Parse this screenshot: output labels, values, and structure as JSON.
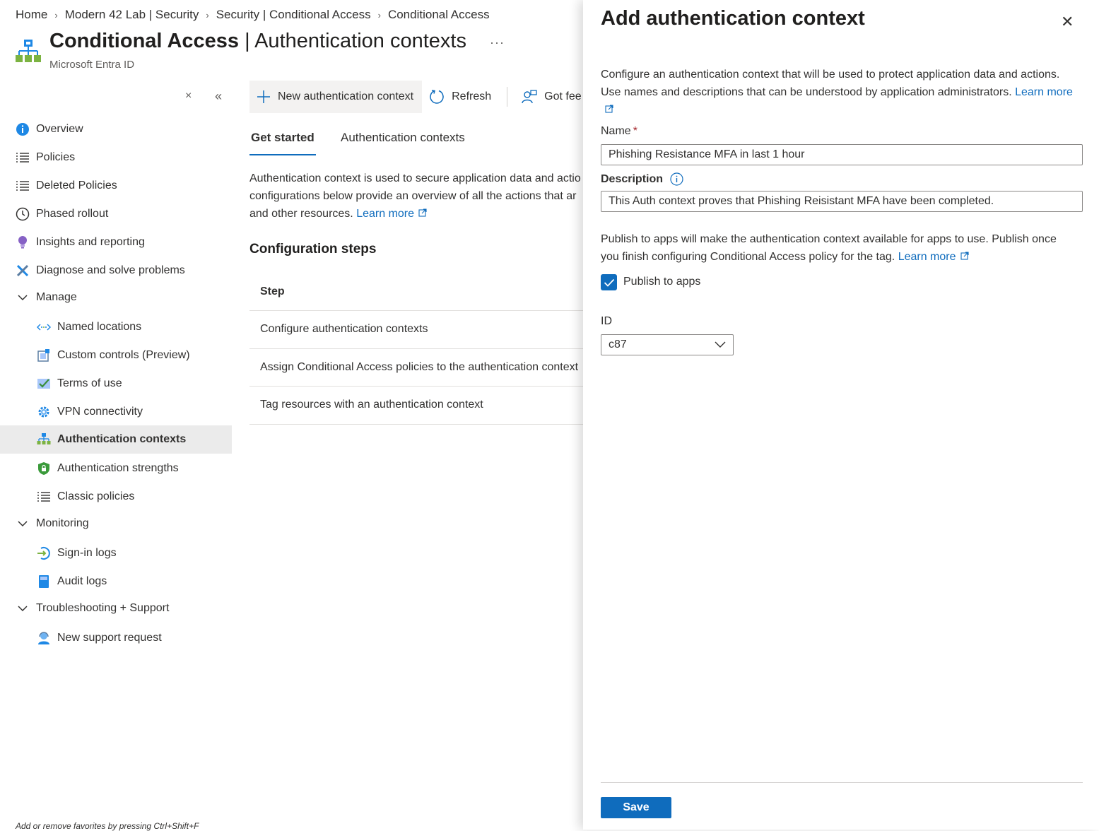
{
  "breadcrumb": [
    "Home",
    "Modern 42 Lab | Security",
    "Security | Conditional Access",
    "Conditional Access"
  ],
  "header": {
    "title_bold": "Conditional Access",
    "title_rest": " | Authentication contexts",
    "subtitle": "Microsoft Entra ID",
    "more": "···"
  },
  "sidebar": {
    "close_glyph": "×",
    "collapse_glyph": "«",
    "items": [
      {
        "label": "Overview",
        "icon": "info-icon"
      },
      {
        "label": "Policies",
        "icon": "list-icon"
      },
      {
        "label": "Deleted Policies",
        "icon": "list-icon"
      },
      {
        "label": "Phased rollout",
        "icon": "clock-icon"
      },
      {
        "label": "Insights and reporting",
        "icon": "lightbulb-icon"
      },
      {
        "label": "Diagnose and solve problems",
        "icon": "wrench-icon"
      }
    ],
    "manage": {
      "label": "Manage",
      "items": [
        {
          "label": "Named locations",
          "icon": "location-arrows-icon"
        },
        {
          "label": "Custom controls (Preview)",
          "icon": "custom-controls-icon"
        },
        {
          "label": "Terms of use",
          "icon": "checklist-icon"
        },
        {
          "label": "VPN connectivity",
          "icon": "gear-icon"
        },
        {
          "label": "Authentication contexts",
          "icon": "hierarchy-icon"
        },
        {
          "label": "Authentication strengths",
          "icon": "shield-lock-icon"
        },
        {
          "label": "Classic policies",
          "icon": "list-icon"
        }
      ]
    },
    "monitoring": {
      "label": "Monitoring",
      "items": [
        {
          "label": "Sign-in logs",
          "icon": "sign-in-icon"
        },
        {
          "label": "Audit logs",
          "icon": "book-icon"
        }
      ]
    },
    "support": {
      "label": "Troubleshooting + Support",
      "items": [
        {
          "label": "New support request",
          "icon": "person-headset-icon"
        }
      ]
    },
    "favorites_hint": "Add or remove favorites by pressing Ctrl+Shift+F"
  },
  "toolbar": {
    "new_context": "New authentication context",
    "refresh": "Refresh",
    "feedback": "Got fee"
  },
  "tabs": [
    "Get started",
    "Authentication contexts"
  ],
  "intro": {
    "line1": "Authentication context is used to secure application data and actio",
    "line2": "configurations below provide an overview of all the actions that ar",
    "line3": "and other resources. ",
    "learn_more": "Learn more"
  },
  "config_heading": "Configuration steps",
  "steps": {
    "header": "Step",
    "rows": [
      "Configure authentication contexts",
      "Assign Conditional Access policies to the authentication context",
      "Tag resources with an authentication context"
    ]
  },
  "panel": {
    "title": "Add authentication context",
    "close_glyph": "✕",
    "desc_line1": "Configure an authentication context that will be used to protect application data and actions.",
    "desc_line2": "Use names and descriptions that can be understood by application administrators. ",
    "desc_learn_more": "Learn more",
    "name_label": "Name",
    "name_required": "*",
    "name_value": "Phishing Resistance MFA in last 1 hour",
    "description_label": "Description",
    "description_value": "This Auth context proves that Phishing Reisistant MFA have been completed.",
    "publish_desc_line1": "Publish to apps will make the authentication context available for apps to use. Publish once",
    "publish_desc_line2": "you finish configuring Conditional Access policy for the tag. ",
    "publish_learn_more": "Learn more",
    "publish_label": "Publish to apps",
    "publish_checked": true,
    "id_label": "ID",
    "id_value": "c87",
    "save_label": "Save"
  },
  "colors": {
    "accent": "#0f6cbd",
    "selected_bg": "#ebebeb"
  }
}
